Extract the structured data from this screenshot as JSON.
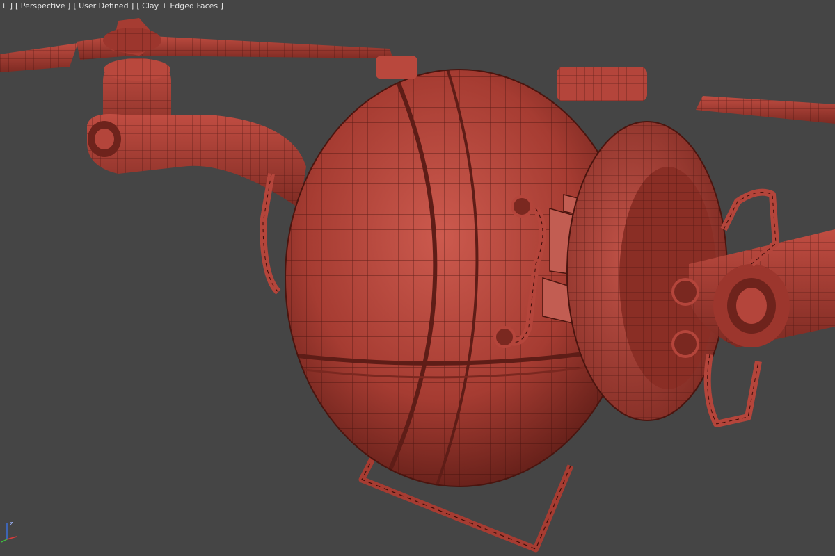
{
  "viewport": {
    "labels": {
      "plus": "+ ]",
      "view": "[ Perspective ]",
      "shading_mode": "[ User Defined ]",
      "shading": "[ Clay + Edged Faces ]"
    },
    "axis_gizmo": {
      "z_label": "z"
    },
    "colors": {
      "background": "#454545",
      "clay": "#b4453b",
      "clay_dark": "#6e231c",
      "wire": "#3a0e0a"
    }
  }
}
